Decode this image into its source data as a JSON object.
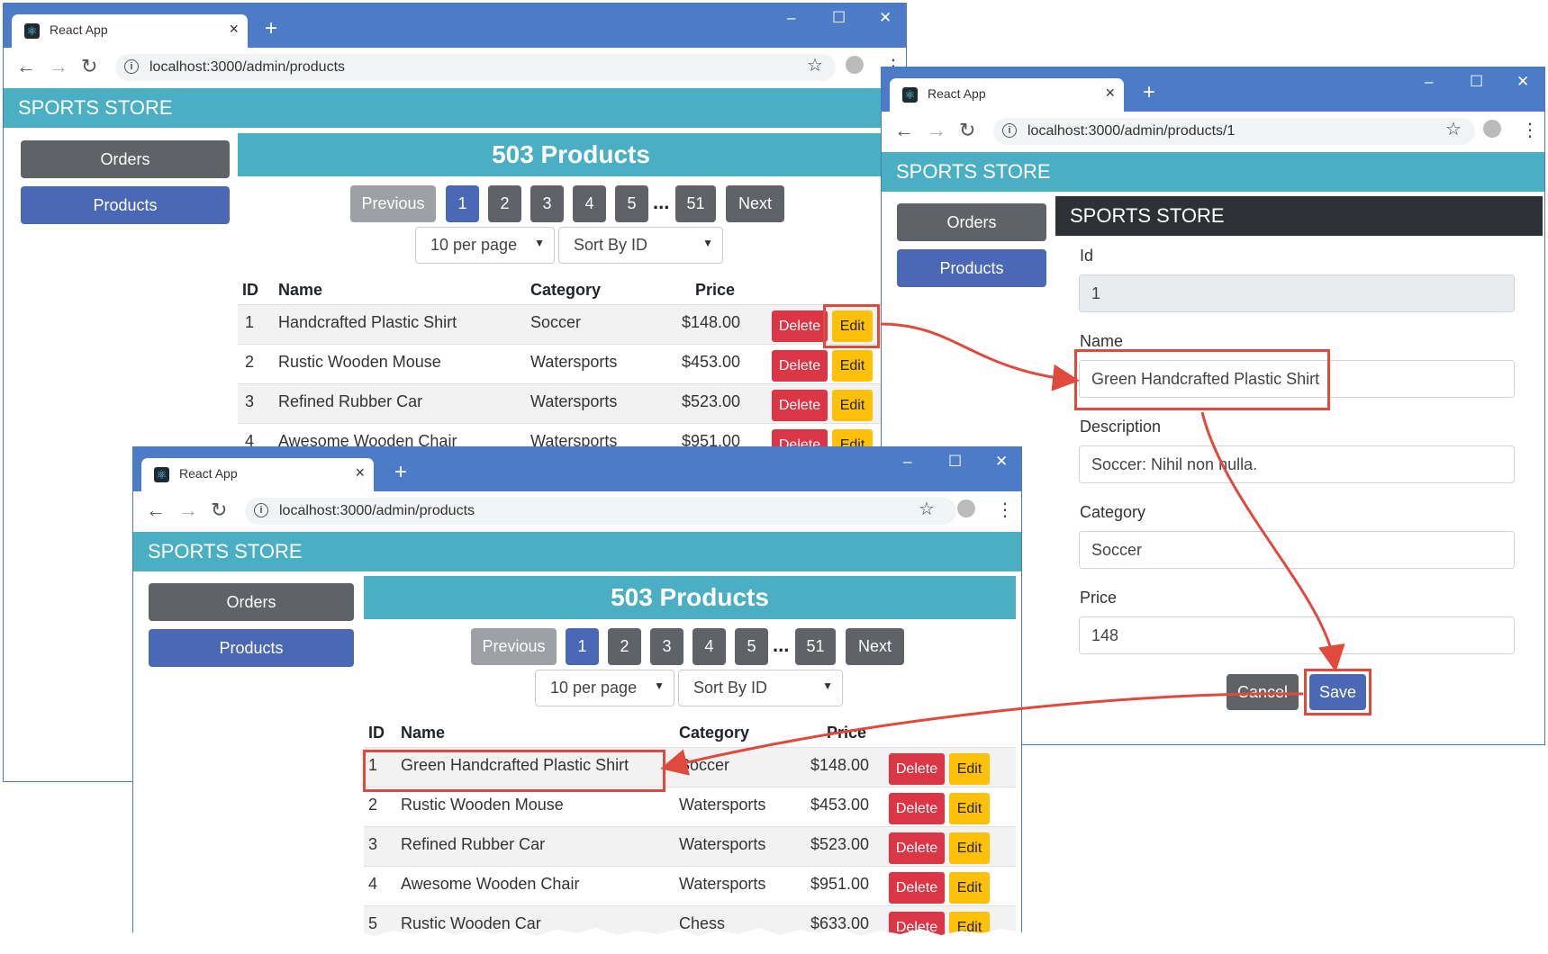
{
  "tab_title": "React App",
  "brand": "SPORTS STORE",
  "window_back": {
    "url": "localhost:3000/admin/products",
    "nav": {
      "orders": "Orders",
      "products": "Products"
    },
    "heading": "503 Products",
    "pagination": {
      "previous": "Previous",
      "pages": [
        "1",
        "2",
        "3",
        "4",
        "5"
      ],
      "ellipsis": "...",
      "last": "51",
      "next": "Next"
    },
    "page_size": "10 per page",
    "sort": "Sort By ID",
    "columns": [
      "ID",
      "Name",
      "Category",
      "Price"
    ],
    "rows": [
      {
        "id": "1",
        "name": "Handcrafted Plastic Shirt",
        "category": "Soccer",
        "price": "$148.00"
      },
      {
        "id": "2",
        "name": "Rustic Wooden Mouse",
        "category": "Watersports",
        "price": "$453.00"
      },
      {
        "id": "3",
        "name": "Refined Rubber Car",
        "category": "Watersports",
        "price": "$523.00"
      },
      {
        "id": "4",
        "name": "Awesome Wooden Chair",
        "category": "Watersports",
        "price": "$951.00"
      }
    ],
    "delete_label": "Delete",
    "edit_label": "Edit"
  },
  "window_editor": {
    "url": "localhost:3000/admin/products/1",
    "nav": {
      "orders": "Orders",
      "products": "Products"
    },
    "header": "SPORTS STORE",
    "fields": {
      "id_label": "Id",
      "id_value": "1",
      "name_label": "Name",
      "name_value": "Green Handcrafted Plastic Shirt",
      "description_label": "Description",
      "description_value": "Soccer: Nihil non nulla.",
      "category_label": "Category",
      "category_value": "Soccer",
      "price_label": "Price",
      "price_value": "148"
    },
    "cancel_label": "Cancel",
    "save_label": "Save"
  },
  "window_front": {
    "url": "localhost:3000/admin/products",
    "nav": {
      "orders": "Orders",
      "products": "Products"
    },
    "heading": "503 Products",
    "pagination": {
      "previous": "Previous",
      "pages": [
        "1",
        "2",
        "3",
        "4",
        "5"
      ],
      "ellipsis": "...",
      "last": "51",
      "next": "Next"
    },
    "page_size": "10 per page",
    "sort": "Sort By ID",
    "columns": [
      "ID",
      "Name",
      "Category",
      "Price"
    ],
    "rows": [
      {
        "id": "1",
        "name": "Green Handcrafted Plastic Shirt",
        "category": "Soccer",
        "price": "$148.00"
      },
      {
        "id": "2",
        "name": "Rustic Wooden Mouse",
        "category": "Watersports",
        "price": "$453.00"
      },
      {
        "id": "3",
        "name": "Refined Rubber Car",
        "category": "Watersports",
        "price": "$523.00"
      },
      {
        "id": "4",
        "name": "Awesome Wooden Chair",
        "category": "Watersports",
        "price": "$951.00"
      },
      {
        "id": "5",
        "name": "Rustic Wooden Car",
        "category": "Chess",
        "price": "$633.00"
      }
    ],
    "delete_label": "Delete",
    "edit_label": "Edit"
  },
  "colors": {
    "accent": "#4aafc2",
    "chrome": "#4c7cc7",
    "danger": "#dc3545",
    "warning": "#ffc107",
    "primary": "#4a68b5",
    "secondary": "#5f6367",
    "highlight": "#e04a3c"
  }
}
